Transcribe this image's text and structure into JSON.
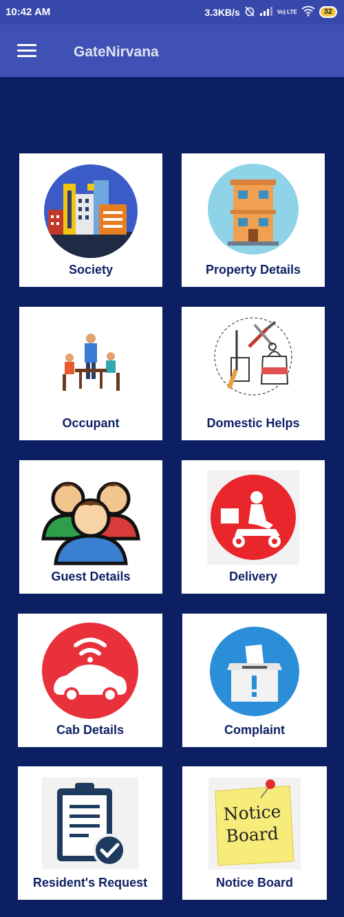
{
  "status_bar": {
    "time": "10:42 AM",
    "speed": "3.3KB/s",
    "battery": "32",
    "network": "Vo) LTE"
  },
  "app_bar": {
    "title": "GateNirvana",
    "menu_icon": "hamburger-menu-icon"
  },
  "menu": [
    {
      "label": "Society",
      "icon": "society-buildings-icon"
    },
    {
      "label": "Property Details",
      "icon": "property-building-icon"
    },
    {
      "label": "Occupant",
      "icon": "occupant-people-icon"
    },
    {
      "label": "Domestic Helps",
      "icon": "domestic-tools-icon"
    },
    {
      "label": "Guest Details",
      "icon": "guest-group-icon"
    },
    {
      "label": "Delivery",
      "icon": "delivery-scooter-icon"
    },
    {
      "label": "Cab Details",
      "icon": "cab-car-icon"
    },
    {
      "label": "Complaint",
      "icon": "complaint-box-icon"
    },
    {
      "label": "Resident's Request",
      "icon": "clipboard-request-icon"
    },
    {
      "label": "Notice Board",
      "icon": "notice-board-icon"
    }
  ],
  "notice_text": {
    "line1": "Notice",
    "line2": "Board"
  },
  "colors": {
    "background": "#0d1f63",
    "app_bar": "#3f51b5",
    "label": "#0d1f63"
  }
}
